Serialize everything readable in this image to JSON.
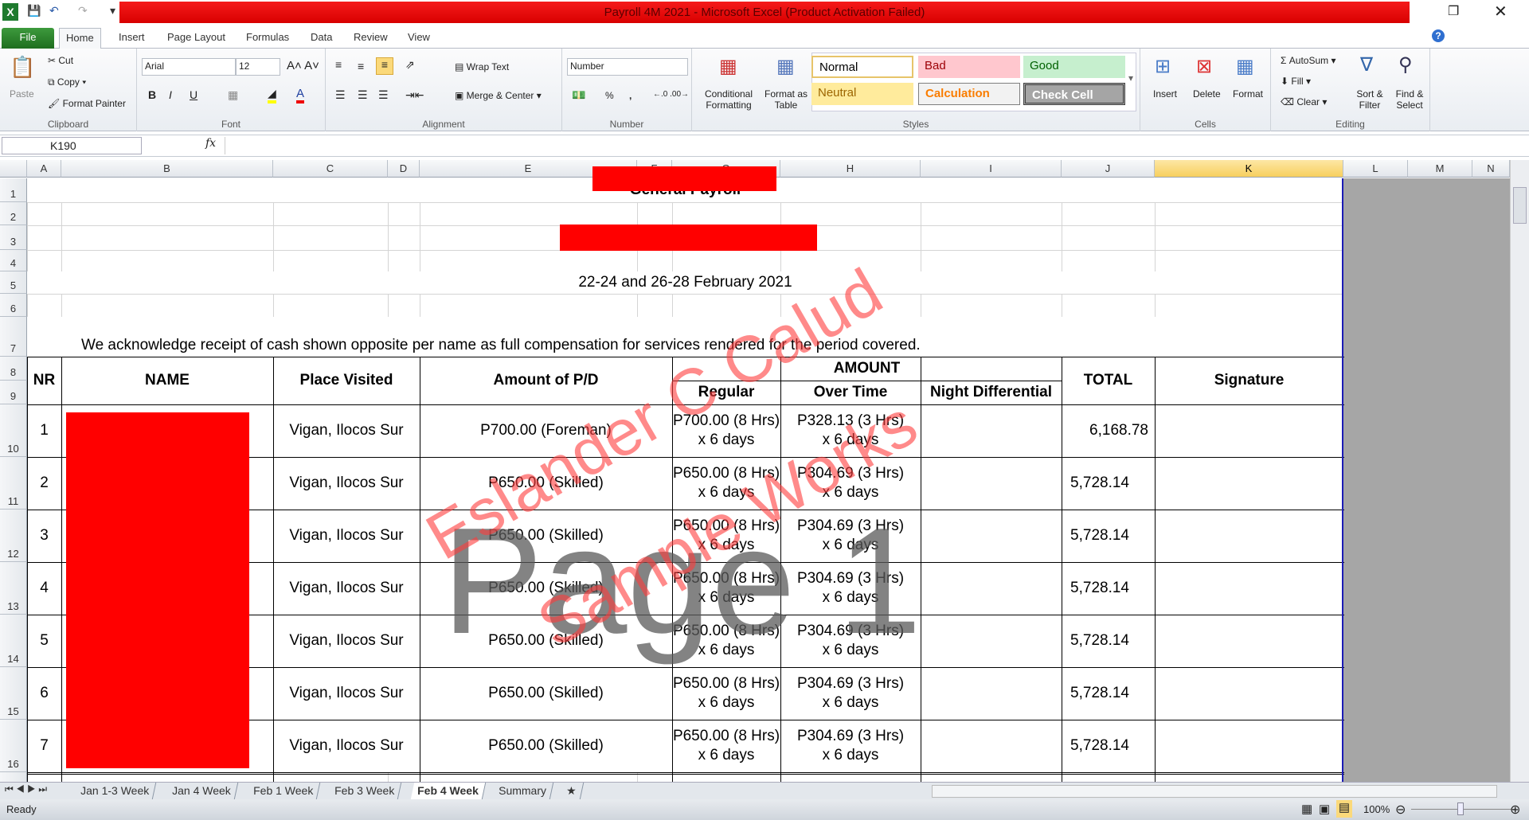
{
  "window": {
    "title": "Payroll 4M 2021  -  Microsoft Excel (Product Activation Failed)"
  },
  "ribbon_tabs": [
    "File",
    "Home",
    "Insert",
    "Page Layout",
    "Formulas",
    "Data",
    "Review",
    "View"
  ],
  "clipboard": {
    "paste": "Paste",
    "cut": "Cut",
    "copy": "Copy",
    "format_painter": "Format Painter",
    "label": "Clipboard"
  },
  "font": {
    "name": "Arial",
    "size": "12",
    "bold": "B",
    "italic": "I",
    "underline": "U",
    "label": "Font"
  },
  "alignment": {
    "wrap": "Wrap Text",
    "merge": "Merge & Center",
    "label": "Alignment"
  },
  "number": {
    "format": "Number",
    "percent": "%",
    "comma": ",",
    "label": "Number"
  },
  "styles": {
    "conditional": "Conditional Formatting",
    "format_table": "Format as Table",
    "normal": "Normal",
    "bad": "Bad",
    "good": "Good",
    "neutral": "Neutral",
    "calculation": "Calculation",
    "check_cell": "Check Cell",
    "label": "Styles"
  },
  "cells_grp": {
    "insert": "Insert",
    "delete": "Delete",
    "format": "Format",
    "label": "Cells"
  },
  "editing": {
    "autosum": "AutoSum",
    "fill": "Fill",
    "clear": "Clear",
    "sort": "Sort & Filter",
    "find": "Find & Select",
    "label": "Editing"
  },
  "formula_bar": {
    "name_box": "K190",
    "fx": "fx",
    "value": ""
  },
  "columns": [
    "A",
    "B",
    "C",
    "D",
    "E",
    "F",
    "G",
    "H",
    "I",
    "J",
    "K",
    "L",
    "M",
    "N"
  ],
  "selected_column": "K",
  "rows": [
    "1",
    "2",
    "3",
    "4",
    "5",
    "6",
    "7",
    "8",
    "9",
    "10",
    "11",
    "12",
    "13",
    "14",
    "15",
    "16"
  ],
  "sheet": {
    "title": "General Payroll",
    "period": "22-24 and 26-28 February 2021",
    "acknowledgement": "We acknowledge receipt of cash shown opposite per name as full compensation for services rendered for the period covered.",
    "headers": {
      "nr": "NR",
      "name": "NAME",
      "place": "Place Visited",
      "amount_pd": "Amount of P/D",
      "amount": "AMOUNT",
      "regular": "Regular",
      "overtime": "Over Time",
      "night": "Night Differential",
      "total": "TOTAL",
      "signature": "Signature"
    },
    "records": [
      {
        "nr": "1",
        "place": "Vigan, Ilocos Sur",
        "pd": "P700.00 (Foreman)",
        "regular": "P700.00 (8 Hrs)\nx 6 days",
        "overtime": "P328.13 (3 Hrs)\nx 6 days",
        "total": "6,168.78"
      },
      {
        "nr": "2",
        "place": "Vigan, Ilocos Sur",
        "pd": "P650.00 (Skilled)",
        "regular": "P650.00 (8 Hrs)\nx 6 days",
        "overtime": "P304.69 (3 Hrs)\nx 6 days",
        "total": "5,728.14"
      },
      {
        "nr": "3",
        "place": "Vigan, Ilocos Sur",
        "pd": "P650.00 (Skilled)",
        "regular": "P650.00 (8 Hrs)\nx 6 days",
        "overtime": "P304.69 (3 Hrs)\nx 6 days",
        "total": "5,728.14"
      },
      {
        "nr": "4",
        "place": "Vigan, Ilocos Sur",
        "pd": "P650.00 (Skilled)",
        "regular": "P650.00 (8 Hrs)\nx 6 days",
        "overtime": "P304.69 (3 Hrs)\nx 6 days",
        "total": "5,728.14"
      },
      {
        "nr": "5",
        "place": "Vigan, Ilocos Sur",
        "pd": "P650.00 (Skilled)",
        "regular": "P650.00 (8 Hrs)\nx 6 days",
        "overtime": "P304.69 (3 Hrs)\nx 6 days",
        "total": "5,728.14"
      },
      {
        "nr": "6",
        "place": "Vigan, Ilocos Sur",
        "pd": "P650.00 (Skilled)",
        "regular": "P650.00 (8 Hrs)\nx 6 days",
        "overtime": "P304.69 (3 Hrs)\nx 6 days",
        "total": "5,728.14"
      },
      {
        "nr": "7",
        "place": "Vigan, Ilocos Sur",
        "pd": "P650.00 (Skilled)",
        "regular": "P650.00 (8 Hrs)\nx 6 days",
        "overtime": "P304.69 (3 Hrs)\nx 6 days",
        "total": "5,728.14"
      }
    ]
  },
  "watermark": {
    "page": "Page 1",
    "name": "Eslander C Calud",
    "works": "Sample Works"
  },
  "sheet_tabs": [
    "Jan 1-3 Week",
    "Jan 4 Week",
    "Feb 1 Week",
    "Feb 3 Week",
    "Feb 4 Week",
    "Summary"
  ],
  "active_sheet": "Feb 4 Week",
  "status": {
    "ready": "Ready",
    "zoom": "100%"
  }
}
